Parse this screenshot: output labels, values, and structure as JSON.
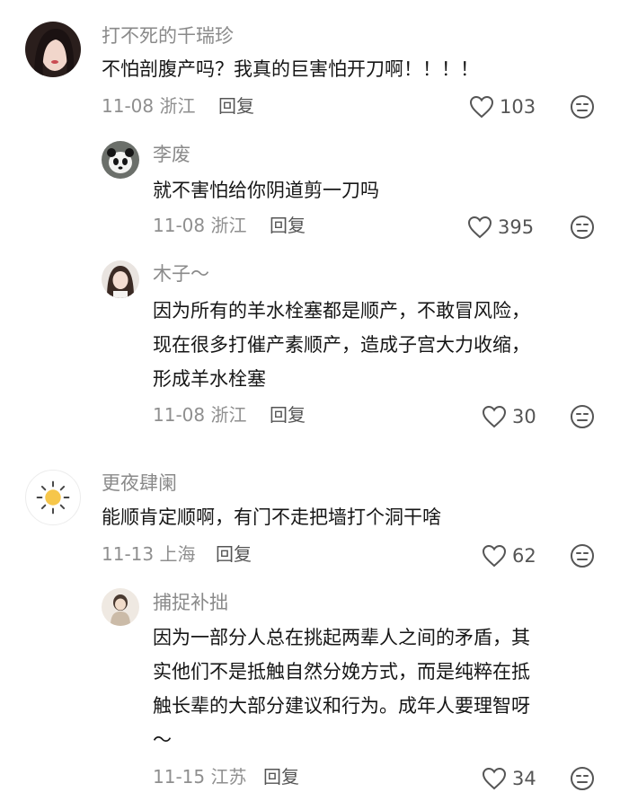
{
  "comments": [
    {
      "username": "打不死的千瑞珍",
      "text": [
        "不怕剖腹产吗？我真的巨害怕开刀啊！！！！"
      ],
      "date": "11-08",
      "location": "浙江",
      "reply_label": "回复",
      "likes": "103",
      "avatar_icon": "avatar-woman-dark-hair",
      "replies": [
        {
          "username": "李废",
          "text": [
            "就不害怕给你阴道剪一刀吗"
          ],
          "date": "11-08",
          "location": "浙江",
          "reply_label": "回复",
          "likes": "395",
          "avatar_icon": "avatar-panda"
        },
        {
          "username": "木子～",
          "text": [
            "因为所有的羊水栓塞都是顺产，不敢冒风险，",
            "现在很多打催产素顺产，造成子宫大力收缩，",
            "形成羊水栓塞"
          ],
          "date": "11-08",
          "location": "浙江",
          "reply_label": "回复",
          "likes": "30",
          "avatar_icon": "avatar-girl-photo"
        }
      ]
    },
    {
      "username": "更夜肆阑",
      "text": [
        "能顺肯定顺啊，有门不走把墙打个洞干啥"
      ],
      "date": "11-13",
      "location": "上海",
      "reply_label": "回复",
      "likes": "62",
      "avatar_icon": "sun-icon",
      "replies": [
        {
          "username": "捕捉补拙",
          "text": [
            "因为一部分人总在挑起两辈人之间的矛盾，其",
            "实他们不是抵触自然分娩方式，而是纯粹在抵",
            "触长辈的大部分建议和行为。成年人要理智呀",
            "～"
          ],
          "date": "11-15",
          "location": "江苏",
          "reply_label": "回复",
          "likes": "34",
          "avatar_icon": "avatar-child-photo"
        }
      ]
    }
  ],
  "colors": {
    "name": "#8a8a8a",
    "text": "#161616",
    "meta": "#8f8f8f",
    "icon": "#555555"
  }
}
